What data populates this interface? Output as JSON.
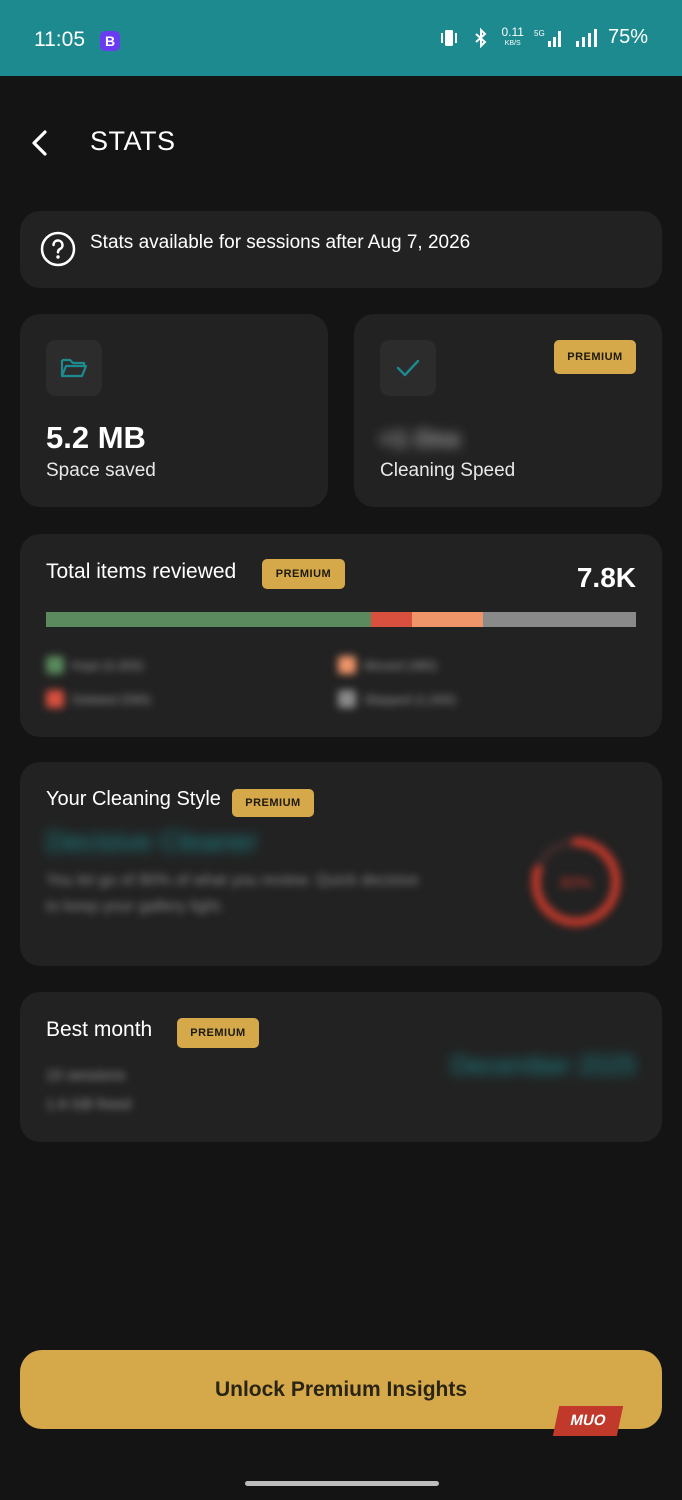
{
  "status_bar": {
    "time": "11:05",
    "app_badge": "B",
    "net_speed": "0.11",
    "net_unit": "KB/S",
    "network": "5G",
    "battery": "75%"
  },
  "header": {
    "title": "STATS"
  },
  "info": {
    "text": "Stats available for sessions after Aug 7, 2026"
  },
  "space_saved": {
    "value": "5.2 MB",
    "label": "Space saved"
  },
  "cleaning_speed": {
    "value": "<1 Onx",
    "label": "Cleaning Speed",
    "badge": "PREMIUM"
  },
  "total_items": {
    "title": "Total items reviewed",
    "badge": "PREMIUM",
    "total": "7.8K",
    "segments": [
      {
        "name": "Kept",
        "fraction": 0.55,
        "color": "#5a8a5e"
      },
      {
        "name": "Deleted",
        "fraction": 0.07,
        "color": "#d9503f"
      },
      {
        "name": "Moved",
        "fraction": 0.12,
        "color": "#f0956a"
      },
      {
        "name": "Skipped",
        "fraction": 0.26,
        "color": "#8a8a8a"
      }
    ],
    "legend": [
      {
        "label": "Kept (4,300)",
        "color": "#5a8a5e"
      },
      {
        "label": "Moved (480)",
        "color": "#f0956a"
      },
      {
        "label": "Deleted (590)",
        "color": "#d9503f"
      },
      {
        "label": "Skipped (1,000)",
        "color": "#8a8a8a"
      }
    ]
  },
  "cleaning_style": {
    "title": "Your Cleaning Style",
    "badge": "PREMIUM",
    "style_name": "Decisive Cleaner",
    "description": "You let go of 80% of what you review. Quick decisive to keep your gallery light.",
    "gauge_percent": 0.8,
    "gauge_label": "80%"
  },
  "best_month": {
    "title": "Best month",
    "badge": "PREMIUM",
    "sessions": "15 sessions",
    "freed": "1.6 GB freed",
    "month": "December 2025"
  },
  "cta": {
    "label": "Unlock Premium Insights"
  },
  "watermark": {
    "text": "MUO"
  },
  "colors": {
    "accent": "#1c8a8e",
    "premium": "#d5a84a",
    "card": "#222222",
    "background": "#141414"
  }
}
